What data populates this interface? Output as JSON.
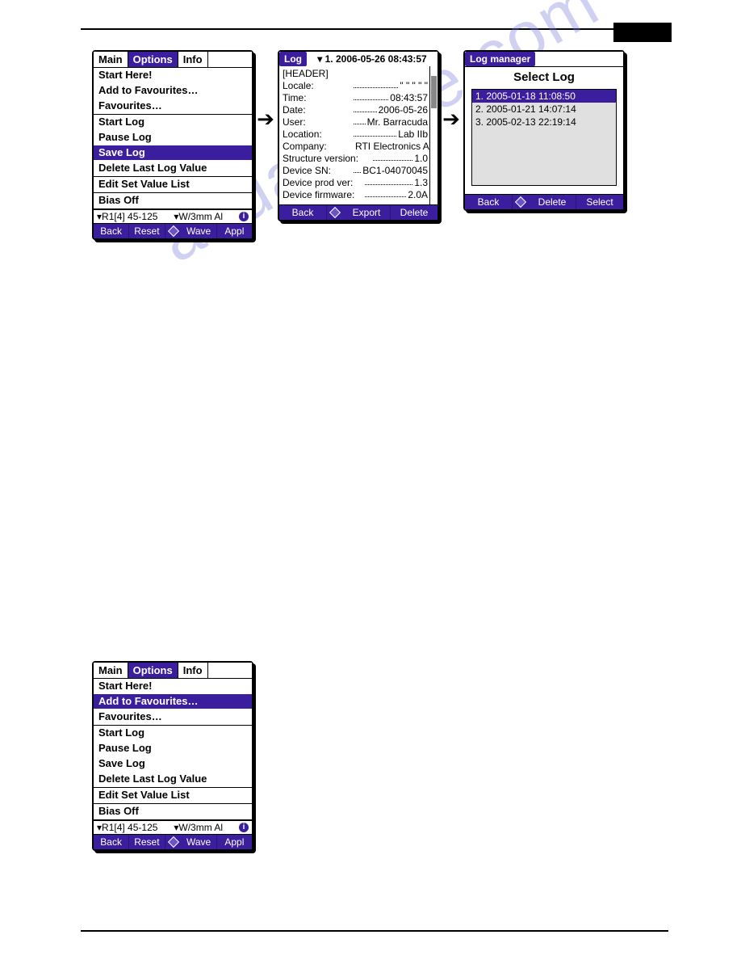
{
  "watermark": "anualshive.com",
  "device_a": {
    "tabs": [
      "Main",
      "Options",
      "Info"
    ],
    "tabs_selected": 1,
    "menu": [
      "Start Here!",
      "Add to Favourites…",
      "Favourites…",
      "Start Log",
      "Pause Log",
      "Save Log",
      "Delete Last Log Value",
      "Edit Set Value List",
      "Bias Off"
    ],
    "menu_selected": 5,
    "status_left": "R1[4] 45-125",
    "status_right": "W/3mm Al",
    "footer": [
      "Back",
      "Reset",
      "Wave",
      "Appl"
    ]
  },
  "device_b": {
    "tag": "Log",
    "dropdown_label": "▾  1. 2006-05-26 08:43:57",
    "header_line": "[HEADER]",
    "rows": [
      {
        "k": "Locale:",
        "v": "\" \" \" \" \""
      },
      {
        "k": "Time:",
        "v": "08:43:57"
      },
      {
        "k": "Date:",
        "v": "2006-05-26"
      },
      {
        "k": "User:",
        "v": "Mr. Barracuda"
      },
      {
        "k": "Location:",
        "v": "Lab IIb"
      },
      {
        "k": "Company:",
        "v": "RTI Electronics AB"
      },
      {
        "k": "Structure version:",
        "v": "1.0"
      },
      {
        "k": "Device SN:",
        "v": "BC1-04070045"
      },
      {
        "k": "Device prod ver:",
        "v": "1.3"
      },
      {
        "k": "Device firmware:",
        "v": "2.0A"
      }
    ],
    "footer": [
      "Back",
      "Export",
      "Delete"
    ]
  },
  "device_c": {
    "tag": "Log manager",
    "title": "Select Log",
    "items": [
      "1. 2005-01-18 11:08:50",
      "2. 2005-01-21 14:07:14",
      "3. 2005-02-13 22:19:14"
    ],
    "items_selected": 0,
    "footer": [
      "Back",
      "Delete",
      "Select"
    ]
  },
  "device_d": {
    "tabs": [
      "Main",
      "Options",
      "Info"
    ],
    "tabs_selected": 1,
    "menu": [
      "Start Here!",
      "Add to Favourites…",
      "Favourites…",
      "Start Log",
      "Pause Log",
      "Save Log",
      "Delete Last Log Value",
      "Edit Set Value List",
      "Bias Off"
    ],
    "menu_selected": 1,
    "status_left": "R1[4] 45-125",
    "status_right": "W/3mm Al",
    "footer": [
      "Back",
      "Reset",
      "Wave",
      "Appl"
    ]
  }
}
